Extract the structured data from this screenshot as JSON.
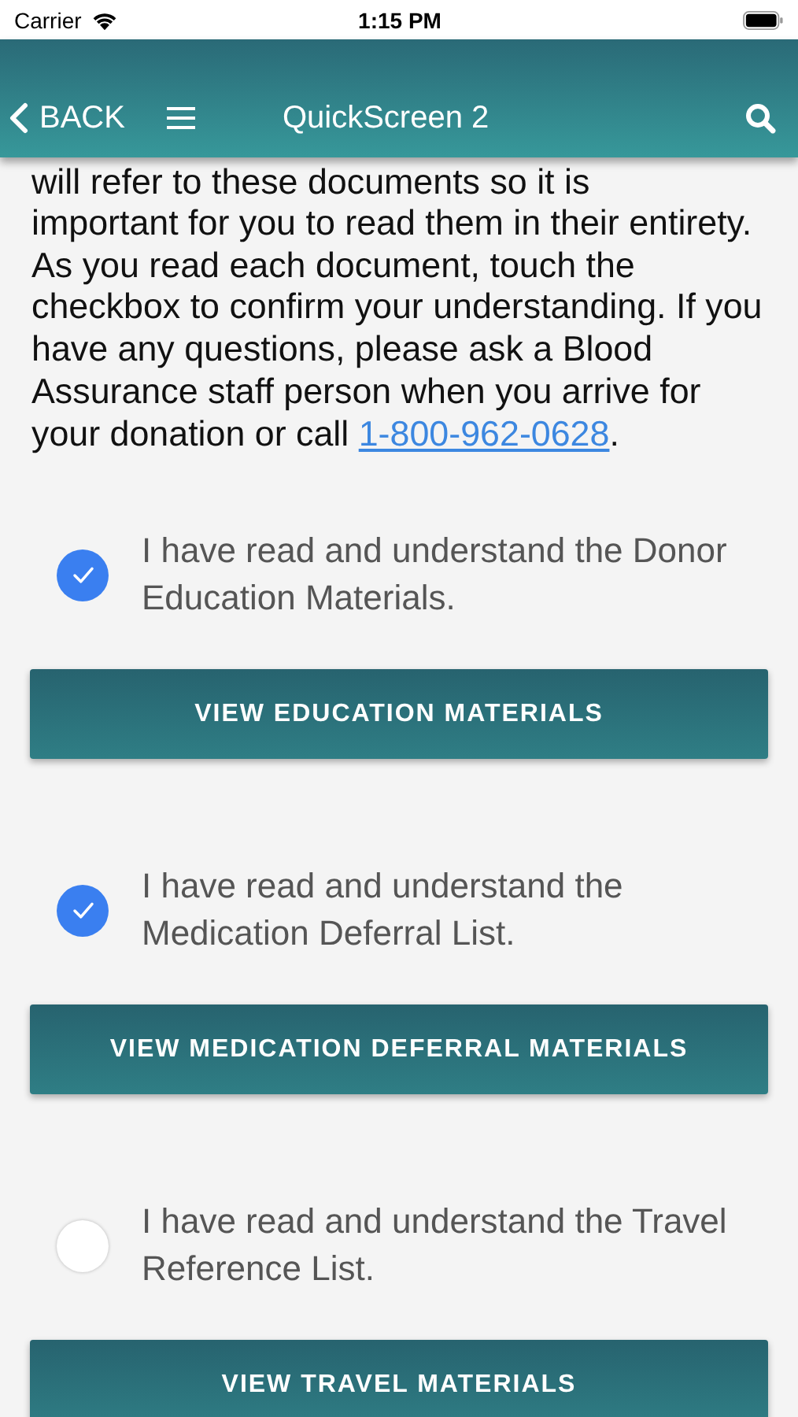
{
  "status_bar": {
    "carrier": "Carrier",
    "time": "1:15 PM"
  },
  "header": {
    "back": "BACK",
    "title": "QuickScreen 2"
  },
  "intro": {
    "cut_line": "will refer to these documents so it is",
    "text": "important for you to read them in their entirety. As you read each document, touch the checkbox to confirm your understanding. If you have any questions, please ask a Blood Assurance staff person when you arrive for your donation or call",
    "phone": "1-800-962-0628",
    "end": "."
  },
  "sections": [
    {
      "label": "I have read and understand the Donor Education Materials.",
      "checked": true,
      "button": "VIEW EDUCATION MATERIALS"
    },
    {
      "label": "I have read and understand the Medication Deferral List.",
      "checked": true,
      "button": "VIEW MEDICATION DEFERRAL MATERIALS"
    },
    {
      "label": "I have read and understand the Travel Reference List.",
      "checked": false,
      "button": "VIEW TRAVEL MATERIALS"
    }
  ]
}
